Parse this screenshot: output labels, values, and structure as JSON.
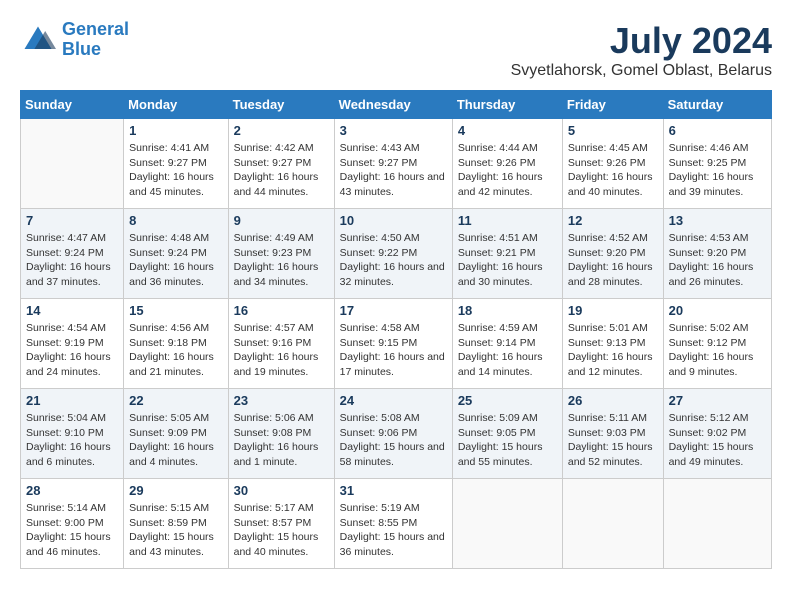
{
  "logo": {
    "text_general": "General",
    "text_blue": "Blue"
  },
  "title": "July 2024",
  "subtitle": "Svyetlahorsk, Gomel Oblast, Belarus",
  "days_of_week": [
    "Sunday",
    "Monday",
    "Tuesday",
    "Wednesday",
    "Thursday",
    "Friday",
    "Saturday"
  ],
  "weeks": [
    [
      {
        "day": "",
        "sunrise": "",
        "sunset": "",
        "daylight": ""
      },
      {
        "day": "1",
        "sunrise": "Sunrise: 4:41 AM",
        "sunset": "Sunset: 9:27 PM",
        "daylight": "Daylight: 16 hours and 45 minutes."
      },
      {
        "day": "2",
        "sunrise": "Sunrise: 4:42 AM",
        "sunset": "Sunset: 9:27 PM",
        "daylight": "Daylight: 16 hours and 44 minutes."
      },
      {
        "day": "3",
        "sunrise": "Sunrise: 4:43 AM",
        "sunset": "Sunset: 9:27 PM",
        "daylight": "Daylight: 16 hours and 43 minutes."
      },
      {
        "day": "4",
        "sunrise": "Sunrise: 4:44 AM",
        "sunset": "Sunset: 9:26 PM",
        "daylight": "Daylight: 16 hours and 42 minutes."
      },
      {
        "day": "5",
        "sunrise": "Sunrise: 4:45 AM",
        "sunset": "Sunset: 9:26 PM",
        "daylight": "Daylight: 16 hours and 40 minutes."
      },
      {
        "day": "6",
        "sunrise": "Sunrise: 4:46 AM",
        "sunset": "Sunset: 9:25 PM",
        "daylight": "Daylight: 16 hours and 39 minutes."
      }
    ],
    [
      {
        "day": "7",
        "sunrise": "Sunrise: 4:47 AM",
        "sunset": "Sunset: 9:24 PM",
        "daylight": "Daylight: 16 hours and 37 minutes."
      },
      {
        "day": "8",
        "sunrise": "Sunrise: 4:48 AM",
        "sunset": "Sunset: 9:24 PM",
        "daylight": "Daylight: 16 hours and 36 minutes."
      },
      {
        "day": "9",
        "sunrise": "Sunrise: 4:49 AM",
        "sunset": "Sunset: 9:23 PM",
        "daylight": "Daylight: 16 hours and 34 minutes."
      },
      {
        "day": "10",
        "sunrise": "Sunrise: 4:50 AM",
        "sunset": "Sunset: 9:22 PM",
        "daylight": "Daylight: 16 hours and 32 minutes."
      },
      {
        "day": "11",
        "sunrise": "Sunrise: 4:51 AM",
        "sunset": "Sunset: 9:21 PM",
        "daylight": "Daylight: 16 hours and 30 minutes."
      },
      {
        "day": "12",
        "sunrise": "Sunrise: 4:52 AM",
        "sunset": "Sunset: 9:20 PM",
        "daylight": "Daylight: 16 hours and 28 minutes."
      },
      {
        "day": "13",
        "sunrise": "Sunrise: 4:53 AM",
        "sunset": "Sunset: 9:20 PM",
        "daylight": "Daylight: 16 hours and 26 minutes."
      }
    ],
    [
      {
        "day": "14",
        "sunrise": "Sunrise: 4:54 AM",
        "sunset": "Sunset: 9:19 PM",
        "daylight": "Daylight: 16 hours and 24 minutes."
      },
      {
        "day": "15",
        "sunrise": "Sunrise: 4:56 AM",
        "sunset": "Sunset: 9:18 PM",
        "daylight": "Daylight: 16 hours and 21 minutes."
      },
      {
        "day": "16",
        "sunrise": "Sunrise: 4:57 AM",
        "sunset": "Sunset: 9:16 PM",
        "daylight": "Daylight: 16 hours and 19 minutes."
      },
      {
        "day": "17",
        "sunrise": "Sunrise: 4:58 AM",
        "sunset": "Sunset: 9:15 PM",
        "daylight": "Daylight: 16 hours and 17 minutes."
      },
      {
        "day": "18",
        "sunrise": "Sunrise: 4:59 AM",
        "sunset": "Sunset: 9:14 PM",
        "daylight": "Daylight: 16 hours and 14 minutes."
      },
      {
        "day": "19",
        "sunrise": "Sunrise: 5:01 AM",
        "sunset": "Sunset: 9:13 PM",
        "daylight": "Daylight: 16 hours and 12 minutes."
      },
      {
        "day": "20",
        "sunrise": "Sunrise: 5:02 AM",
        "sunset": "Sunset: 9:12 PM",
        "daylight": "Daylight: 16 hours and 9 minutes."
      }
    ],
    [
      {
        "day": "21",
        "sunrise": "Sunrise: 5:04 AM",
        "sunset": "Sunset: 9:10 PM",
        "daylight": "Daylight: 16 hours and 6 minutes."
      },
      {
        "day": "22",
        "sunrise": "Sunrise: 5:05 AM",
        "sunset": "Sunset: 9:09 PM",
        "daylight": "Daylight: 16 hours and 4 minutes."
      },
      {
        "day": "23",
        "sunrise": "Sunrise: 5:06 AM",
        "sunset": "Sunset: 9:08 PM",
        "daylight": "Daylight: 16 hours and 1 minute."
      },
      {
        "day": "24",
        "sunrise": "Sunrise: 5:08 AM",
        "sunset": "Sunset: 9:06 PM",
        "daylight": "Daylight: 15 hours and 58 minutes."
      },
      {
        "day": "25",
        "sunrise": "Sunrise: 5:09 AM",
        "sunset": "Sunset: 9:05 PM",
        "daylight": "Daylight: 15 hours and 55 minutes."
      },
      {
        "day": "26",
        "sunrise": "Sunrise: 5:11 AM",
        "sunset": "Sunset: 9:03 PM",
        "daylight": "Daylight: 15 hours and 52 minutes."
      },
      {
        "day": "27",
        "sunrise": "Sunrise: 5:12 AM",
        "sunset": "Sunset: 9:02 PM",
        "daylight": "Daylight: 15 hours and 49 minutes."
      }
    ],
    [
      {
        "day": "28",
        "sunrise": "Sunrise: 5:14 AM",
        "sunset": "Sunset: 9:00 PM",
        "daylight": "Daylight: 15 hours and 46 minutes."
      },
      {
        "day": "29",
        "sunrise": "Sunrise: 5:15 AM",
        "sunset": "Sunset: 8:59 PM",
        "daylight": "Daylight: 15 hours and 43 minutes."
      },
      {
        "day": "30",
        "sunrise": "Sunrise: 5:17 AM",
        "sunset": "Sunset: 8:57 PM",
        "daylight": "Daylight: 15 hours and 40 minutes."
      },
      {
        "day": "31",
        "sunrise": "Sunrise: 5:19 AM",
        "sunset": "Sunset: 8:55 PM",
        "daylight": "Daylight: 15 hours and 36 minutes."
      },
      {
        "day": "",
        "sunrise": "",
        "sunset": "",
        "daylight": ""
      },
      {
        "day": "",
        "sunrise": "",
        "sunset": "",
        "daylight": ""
      },
      {
        "day": "",
        "sunrise": "",
        "sunset": "",
        "daylight": ""
      }
    ]
  ]
}
